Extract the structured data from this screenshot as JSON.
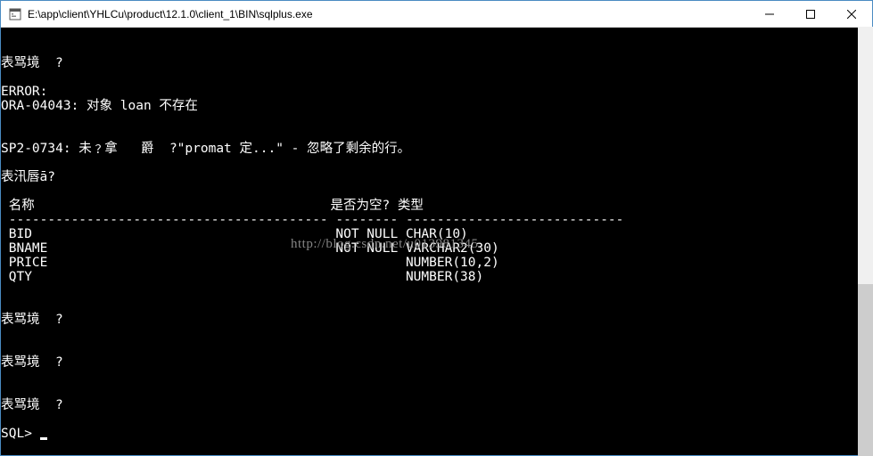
{
  "window": {
    "title": "E:\\app\\client\\YHLCu\\product\\12.1.0\\client_1\\BIN\\sqlplus.exe"
  },
  "terminal": {
    "lines": [
      "表骂境  ?",
      "",
      "ERROR:",
      "ORA-04043: 对象 loan 不存在",
      "",
      "",
      "SP2-0734: 未﹖拿   爵  ?\"promat 定...\" - 忽略了剩余的行。",
      "",
      "表汛唇ā?",
      "",
      " 名称                                      是否为空? 类型",
      " ----------------------------------------- -------- ----------------------------",
      " BID                                       NOT NULL CHAR(10)",
      " BNAME                                     NOT NULL VARCHAR2(30)",
      " PRICE                                              NUMBER(10,2)",
      " QTY                                                NUMBER(38)",
      "",
      "",
      "表骂境  ?",
      "",
      "",
      "表骂境  ?",
      "",
      "",
      "表骂境  ?",
      "",
      "SQL> "
    ],
    "prompt": "SQL> "
  },
  "watermark": "http://blog.csdn.net/u013981345"
}
